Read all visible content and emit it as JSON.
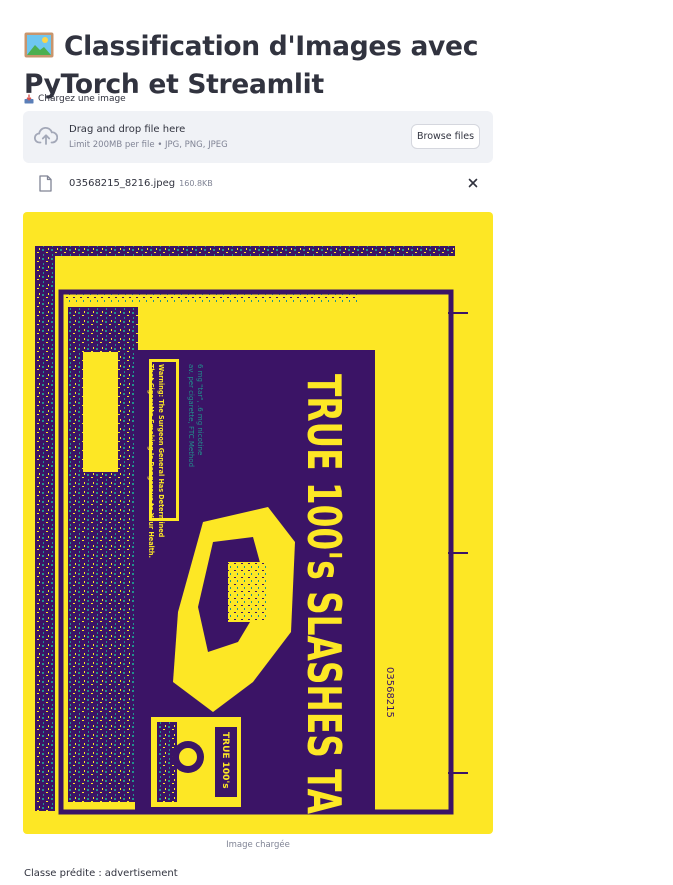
{
  "header": {
    "title": "Classification d'Images avec PyTorch et Streamlit",
    "title_icon": "framed-picture-emoji"
  },
  "uploader": {
    "label": "Chargez une image",
    "label_icon": "inbox-tray-emoji",
    "dropzone_title": "Drag and drop file here",
    "dropzone_subtitle": "Limit 200MB per file • JPG, PNG, JPEG",
    "browse_label": "Browse files",
    "cloud_icon": "cloud-upload-icon"
  },
  "uploaded_file": {
    "name": "03568215_8216.jpeg",
    "size": "160.8KB",
    "file_icon": "file-icon",
    "remove_icon": "close-icon"
  },
  "image": {
    "caption": "Image chargée",
    "colors": {
      "background": "#fde725",
      "dark": "#3b1466",
      "mid": "#21918c"
    },
    "headline": "TRUE 100's SLASHES TA",
    "warning": [
      "Warning: The Surgeon General Has Determined",
      "That Cigarette Smoking Is Dangerous to Your Health."
    ],
    "tar_notice": [
      "6 mg \"tar\", .6 mg nicotine",
      "av. per cigarette, FTC Method"
    ],
    "code": "03568215",
    "pack_text": "TRUE 100's"
  },
  "result": {
    "label": "Classe prédite :",
    "value": "advertisement"
  },
  "colors": {
    "text": "#31333f",
    "muted": "#808495",
    "dropzone_bg": "#f0f2f6",
    "border": "#d5d7de"
  }
}
